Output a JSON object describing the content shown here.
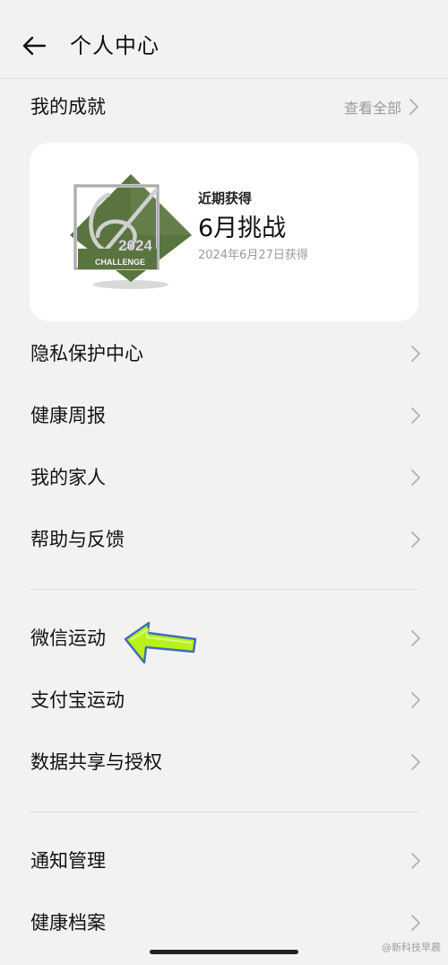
{
  "header": {
    "title": "个人中心"
  },
  "achievements": {
    "title": "我的成就",
    "view_all": "查看全部",
    "card": {
      "caption": "近期获得",
      "name": "6月挑战",
      "date": "2024年6月27日获得",
      "badge": {
        "year": "2024",
        "label": "CHALLENGE",
        "color": "#5a7440"
      }
    }
  },
  "groups": [
    [
      "隐私保护中心",
      "健康周报",
      "我的家人",
      "帮助与反馈"
    ],
    [
      "微信运动",
      "支付宝运动",
      "数据共享与授权"
    ],
    [
      "通知管理",
      "健康档案"
    ]
  ],
  "annotation": {
    "arrow_color": "#b8f21a",
    "arrow_target": "微信运动"
  },
  "watermark": "@新科技早晨"
}
